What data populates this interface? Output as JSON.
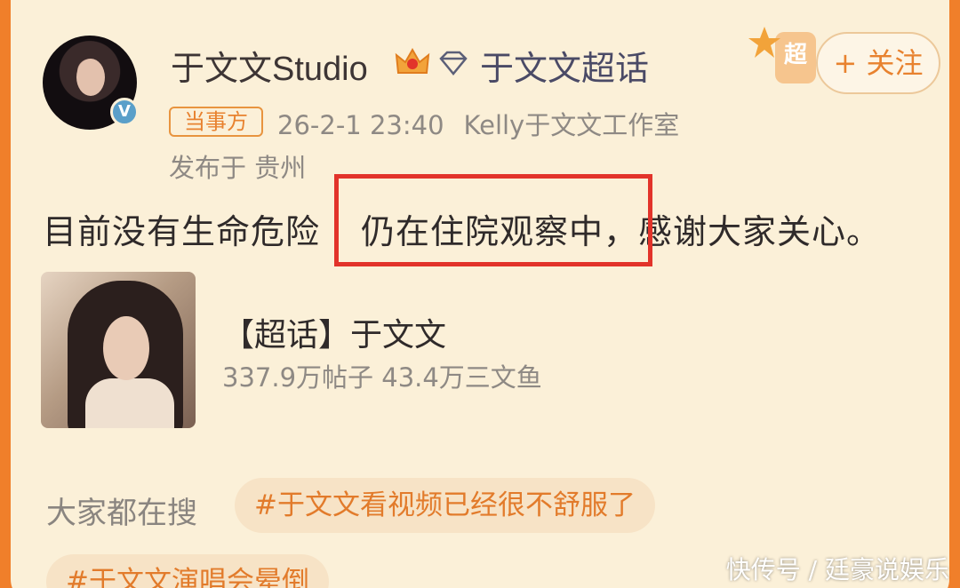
{
  "post": {
    "author_name": "于文文Studio",
    "super_topic_link": "于文文超话",
    "super_badge_char": "超",
    "follow_label": "+ 关注",
    "role_tag": "当事方",
    "timestamp": "26-2-1 23:40",
    "source": "Kelly于文文工作室",
    "location": "发布于 贵州",
    "text_before": "目前没有生命危险",
    "text_highlight": "仍在住院观察中，",
    "text_after": "感谢大家关心。",
    "verified_mark": "V"
  },
  "topic_card": {
    "title": "【超话】于文文",
    "stats": "337.9万帖子 43.4万三文鱼"
  },
  "search": {
    "label": "大家都在搜",
    "chips": [
      "#于文文看视频已经很不舒服了",
      "#于文文演唱会晕倒"
    ]
  },
  "watermark": "快传号 / 廷豪说娱乐",
  "colors": {
    "background": "#f07f2a",
    "card": "#fbf0d8",
    "accent": "#e8822f",
    "highlight_border": "#e2332a",
    "chip_bg": "#f7e3c6"
  },
  "icons": [
    "crown-icon",
    "diamond-icon",
    "verified-icon",
    "super-topic-badge-icon"
  ]
}
